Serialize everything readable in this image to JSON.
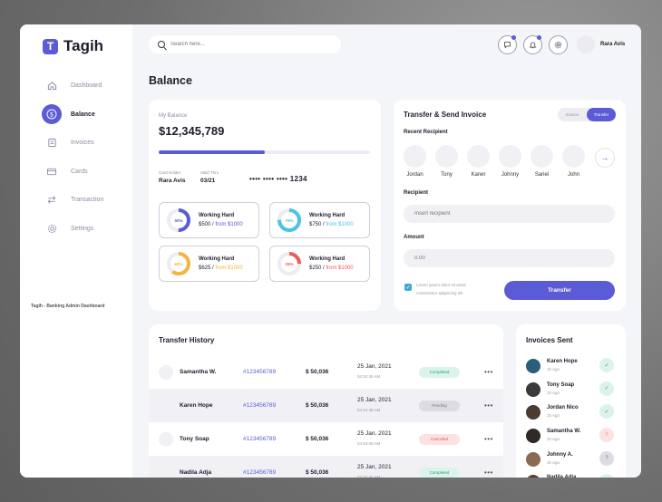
{
  "sidebar": {
    "brand": {
      "logo_letter": "T",
      "name": "Tagih"
    },
    "items": [
      {
        "label": "Dashboard",
        "icon": "home-icon"
      },
      {
        "label": "Balance",
        "icon": "dollar-icon",
        "active": true
      },
      {
        "label": "Invoices",
        "icon": "invoice-icon"
      },
      {
        "label": "Cards",
        "icon": "card-icon"
      },
      {
        "label": "Transaction",
        "icon": "transfer-arrows-icon"
      },
      {
        "label": "Settings",
        "icon": "gear-icon"
      }
    ],
    "footer": "Tagih - Banking Admin Dashboard"
  },
  "topbar": {
    "search_placeholder": "Search here...",
    "icons": [
      "chat-icon",
      "bell-icon",
      "settings-circle-icon"
    ],
    "user_name": "Rara Avis"
  },
  "page_title": "Balance",
  "balance": {
    "label": "My Balance",
    "amount": "$12,345,789",
    "progress": 0.5,
    "card_holder_label": "Card Holder",
    "card_holder": "Rara Avis",
    "valid_label": "Valid Thru",
    "valid": "03/21",
    "card_number": "•••• •••• •••• 1234",
    "goals": [
      {
        "title": "Working Hard",
        "percent": "50%",
        "pct": 0.5,
        "amount": "$500 / ",
        "target": "from $1000",
        "color": "#5b5bd6"
      },
      {
        "title": "Working Hard",
        "percent": "75%",
        "pct": 0.75,
        "amount": "$750 / ",
        "target": "from $1000",
        "color": "#4cc3e8"
      },
      {
        "title": "Working Hard",
        "percent": "60%",
        "pct": 0.6,
        "amount": "$625 / ",
        "target": "from $1000",
        "color": "#f5b53f"
      },
      {
        "title": "Working Hard",
        "percent": "25%",
        "pct": 0.25,
        "amount": "$250 / ",
        "target": "from $1000",
        "color": "#ef5a5a"
      }
    ]
  },
  "transfer": {
    "title": "Transfer & Send Invoice",
    "toggle": {
      "invoice": "Invoice",
      "transfer": "Transfer"
    },
    "recent_label": "Recent Recipient",
    "recipients": [
      "Jordan",
      "Tony",
      "Karen",
      "Johnny",
      "Sariel",
      "John"
    ],
    "recipient_label": "Recipient",
    "recipient_placeholder": "Insert recipient",
    "amount_label": "Amount",
    "amount_placeholder": "0.00",
    "checkbox_text": "Lorem ipsum dolor sit amet, consectetur adipiscing elit",
    "button": "Transfer"
  },
  "history": {
    "title": "Transfer History",
    "rows": [
      {
        "name": "Samantha W.",
        "id": "#123456789",
        "amount": "$ 50,036",
        "date": "25 Jan, 2021",
        "time": "04:34:45 AM",
        "status": "Completed",
        "status_class": "completed",
        "more": "•••"
      },
      {
        "name": "Karen Hope",
        "id": "#123456789",
        "amount": "$ 50,036",
        "date": "25 Jan, 2021",
        "time": "04:34:45 AM",
        "status": "Pending",
        "status_class": "pending",
        "more": "•••"
      },
      {
        "name": "Tony Soap",
        "id": "#123456789",
        "amount": "$ 50,036",
        "date": "25 Jan, 2021",
        "time": "04:34:45 AM",
        "status": "Canceled",
        "status_class": "canceled",
        "more": "•••"
      },
      {
        "name": "Nadila Adja",
        "id": "#123456789",
        "amount": "$ 50,036",
        "date": "25 Jan, 2021",
        "time": "04:34:45 AM",
        "status": "Completed",
        "status_class": "completed",
        "more": "•••"
      }
    ]
  },
  "invoices": {
    "title": "Invoices Sent",
    "items": [
      {
        "name": "Karen Hope",
        "time": "1h Ago",
        "status": "ok",
        "avatar_color": "#2b5d7d"
      },
      {
        "name": "Tony Soap",
        "time": "1h Ago",
        "status": "ok",
        "avatar_color": "#3a3a3a"
      },
      {
        "name": "Jordan Nico",
        "time": "1h Ago",
        "status": "ok",
        "avatar_color": "#4a3b33"
      },
      {
        "name": "Samantha W.",
        "time": "1h Ago",
        "status": "err",
        "avatar_color": "#2f2a28"
      },
      {
        "name": "Johnny A.",
        "time": "1h Ago",
        "status": "wait",
        "avatar_color": "#8a6a52"
      },
      {
        "name": "Nadila Adja",
        "time": "1h Ago",
        "status": "ok",
        "avatar_color": "#5a3d35"
      }
    ]
  },
  "colors": {
    "accent": "#5b5bd6",
    "success": "#22a27a",
    "danger": "#e05252",
    "muted": "#8b8fa3"
  }
}
